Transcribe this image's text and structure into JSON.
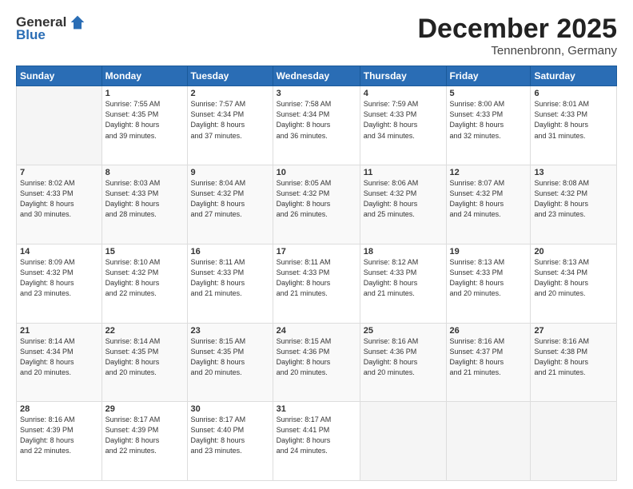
{
  "logo": {
    "general": "General",
    "blue": "Blue"
  },
  "title": "December 2025",
  "location": "Tennenbronn, Germany",
  "headers": [
    "Sunday",
    "Monday",
    "Tuesday",
    "Wednesday",
    "Thursday",
    "Friday",
    "Saturday"
  ],
  "weeks": [
    [
      {
        "num": "",
        "info": ""
      },
      {
        "num": "1",
        "info": "Sunrise: 7:55 AM\nSunset: 4:35 PM\nDaylight: 8 hours\nand 39 minutes."
      },
      {
        "num": "2",
        "info": "Sunrise: 7:57 AM\nSunset: 4:34 PM\nDaylight: 8 hours\nand 37 minutes."
      },
      {
        "num": "3",
        "info": "Sunrise: 7:58 AM\nSunset: 4:34 PM\nDaylight: 8 hours\nand 36 minutes."
      },
      {
        "num": "4",
        "info": "Sunrise: 7:59 AM\nSunset: 4:33 PM\nDaylight: 8 hours\nand 34 minutes."
      },
      {
        "num": "5",
        "info": "Sunrise: 8:00 AM\nSunset: 4:33 PM\nDaylight: 8 hours\nand 32 minutes."
      },
      {
        "num": "6",
        "info": "Sunrise: 8:01 AM\nSunset: 4:33 PM\nDaylight: 8 hours\nand 31 minutes."
      }
    ],
    [
      {
        "num": "7",
        "info": "Sunrise: 8:02 AM\nSunset: 4:33 PM\nDaylight: 8 hours\nand 30 minutes."
      },
      {
        "num": "8",
        "info": "Sunrise: 8:03 AM\nSunset: 4:33 PM\nDaylight: 8 hours\nand 28 minutes."
      },
      {
        "num": "9",
        "info": "Sunrise: 8:04 AM\nSunset: 4:32 PM\nDaylight: 8 hours\nand 27 minutes."
      },
      {
        "num": "10",
        "info": "Sunrise: 8:05 AM\nSunset: 4:32 PM\nDaylight: 8 hours\nand 26 minutes."
      },
      {
        "num": "11",
        "info": "Sunrise: 8:06 AM\nSunset: 4:32 PM\nDaylight: 8 hours\nand 25 minutes."
      },
      {
        "num": "12",
        "info": "Sunrise: 8:07 AM\nSunset: 4:32 PM\nDaylight: 8 hours\nand 24 minutes."
      },
      {
        "num": "13",
        "info": "Sunrise: 8:08 AM\nSunset: 4:32 PM\nDaylight: 8 hours\nand 23 minutes."
      }
    ],
    [
      {
        "num": "14",
        "info": "Sunrise: 8:09 AM\nSunset: 4:32 PM\nDaylight: 8 hours\nand 23 minutes."
      },
      {
        "num": "15",
        "info": "Sunrise: 8:10 AM\nSunset: 4:32 PM\nDaylight: 8 hours\nand 22 minutes."
      },
      {
        "num": "16",
        "info": "Sunrise: 8:11 AM\nSunset: 4:33 PM\nDaylight: 8 hours\nand 21 minutes."
      },
      {
        "num": "17",
        "info": "Sunrise: 8:11 AM\nSunset: 4:33 PM\nDaylight: 8 hours\nand 21 minutes."
      },
      {
        "num": "18",
        "info": "Sunrise: 8:12 AM\nSunset: 4:33 PM\nDaylight: 8 hours\nand 21 minutes."
      },
      {
        "num": "19",
        "info": "Sunrise: 8:13 AM\nSunset: 4:33 PM\nDaylight: 8 hours\nand 20 minutes."
      },
      {
        "num": "20",
        "info": "Sunrise: 8:13 AM\nSunset: 4:34 PM\nDaylight: 8 hours\nand 20 minutes."
      }
    ],
    [
      {
        "num": "21",
        "info": "Sunrise: 8:14 AM\nSunset: 4:34 PM\nDaylight: 8 hours\nand 20 minutes."
      },
      {
        "num": "22",
        "info": "Sunrise: 8:14 AM\nSunset: 4:35 PM\nDaylight: 8 hours\nand 20 minutes."
      },
      {
        "num": "23",
        "info": "Sunrise: 8:15 AM\nSunset: 4:35 PM\nDaylight: 8 hours\nand 20 minutes."
      },
      {
        "num": "24",
        "info": "Sunrise: 8:15 AM\nSunset: 4:36 PM\nDaylight: 8 hours\nand 20 minutes."
      },
      {
        "num": "25",
        "info": "Sunrise: 8:16 AM\nSunset: 4:36 PM\nDaylight: 8 hours\nand 20 minutes."
      },
      {
        "num": "26",
        "info": "Sunrise: 8:16 AM\nSunset: 4:37 PM\nDaylight: 8 hours\nand 21 minutes."
      },
      {
        "num": "27",
        "info": "Sunrise: 8:16 AM\nSunset: 4:38 PM\nDaylight: 8 hours\nand 21 minutes."
      }
    ],
    [
      {
        "num": "28",
        "info": "Sunrise: 8:16 AM\nSunset: 4:39 PM\nDaylight: 8 hours\nand 22 minutes."
      },
      {
        "num": "29",
        "info": "Sunrise: 8:17 AM\nSunset: 4:39 PM\nDaylight: 8 hours\nand 22 minutes."
      },
      {
        "num": "30",
        "info": "Sunrise: 8:17 AM\nSunset: 4:40 PM\nDaylight: 8 hours\nand 23 minutes."
      },
      {
        "num": "31",
        "info": "Sunrise: 8:17 AM\nSunset: 4:41 PM\nDaylight: 8 hours\nand 24 minutes."
      },
      {
        "num": "",
        "info": ""
      },
      {
        "num": "",
        "info": ""
      },
      {
        "num": "",
        "info": ""
      }
    ]
  ]
}
